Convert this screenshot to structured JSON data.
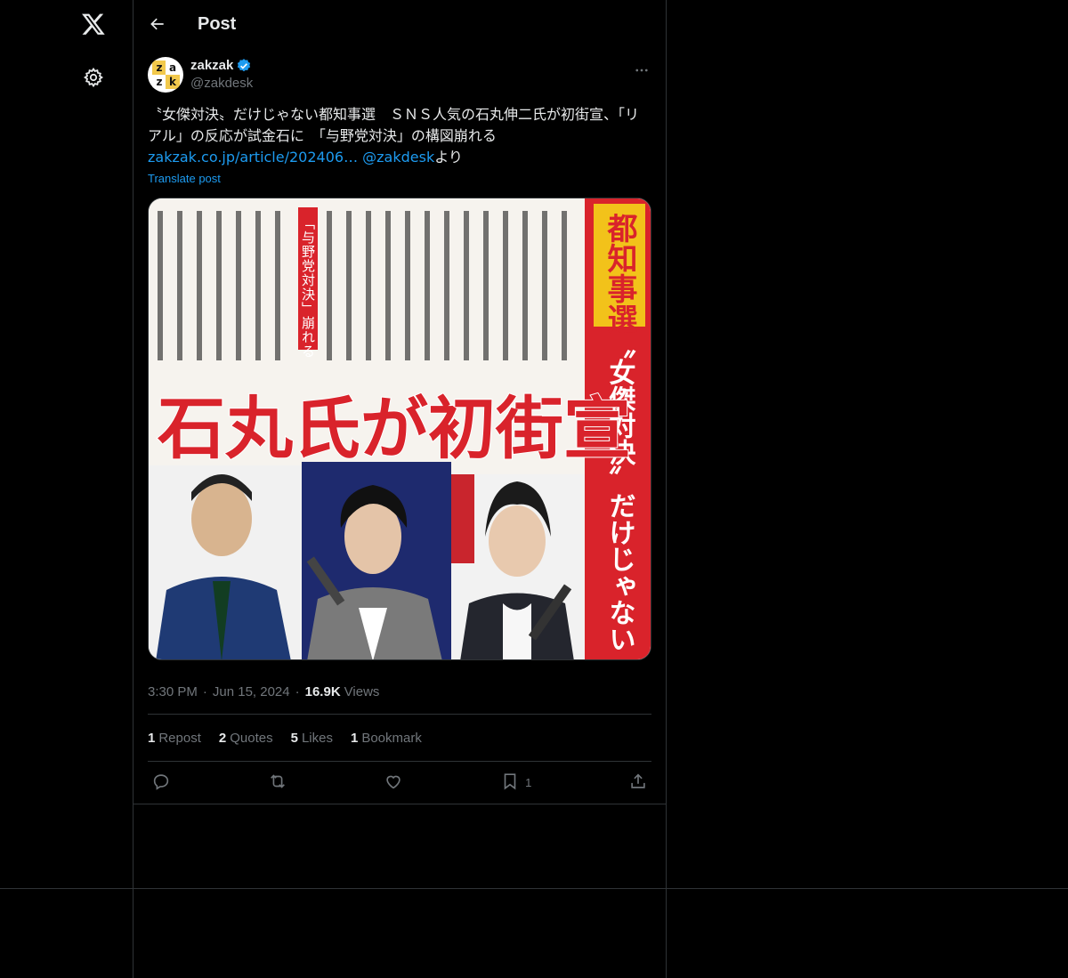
{
  "header": {
    "title": "Post"
  },
  "tweet": {
    "author": {
      "display_name": "zakzak",
      "handle": "@zakdesk"
    },
    "text_main": "〝女傑対決〟だけじゃない都知事選　ＳＮＳ人気の石丸伸二氏が初街宣、「リアル」の反応が試金石に　「与野党対決」の構図崩れる",
    "link": "zakzak.co.jp/article/202406…",
    "mention": "@zakdesk",
    "text_suffix": "より",
    "translate": "Translate post",
    "image": {
      "corner_label": "都知事選",
      "side_headline": "〝女傑対決〟だけじゃない",
      "headline": "石丸氏が初街宣",
      "inset_label": "「与野党対決」崩れる"
    },
    "time": "3:30 PM",
    "date": "Jun 15, 2024",
    "views_count": "16.9K",
    "views_label": "Views",
    "stats": {
      "reposts_count": "1",
      "reposts_label": "Repost",
      "quotes_count": "2",
      "quotes_label": "Quotes",
      "likes_count": "5",
      "likes_label": "Likes",
      "bookmarks_count": "1",
      "bookmarks_label": "Bookmark"
    },
    "actions": {
      "bookmark_count": "1"
    }
  },
  "colors": {
    "accent": "#1d9bf0",
    "background": "#000000",
    "muted": "#71767b",
    "border": "#2f3336"
  },
  "icons": [
    "x-logo-icon",
    "gear-icon",
    "back-arrow-icon",
    "verified-badge-icon",
    "more-icon",
    "reply-icon",
    "repost-icon",
    "like-icon",
    "bookmark-icon",
    "share-icon"
  ]
}
